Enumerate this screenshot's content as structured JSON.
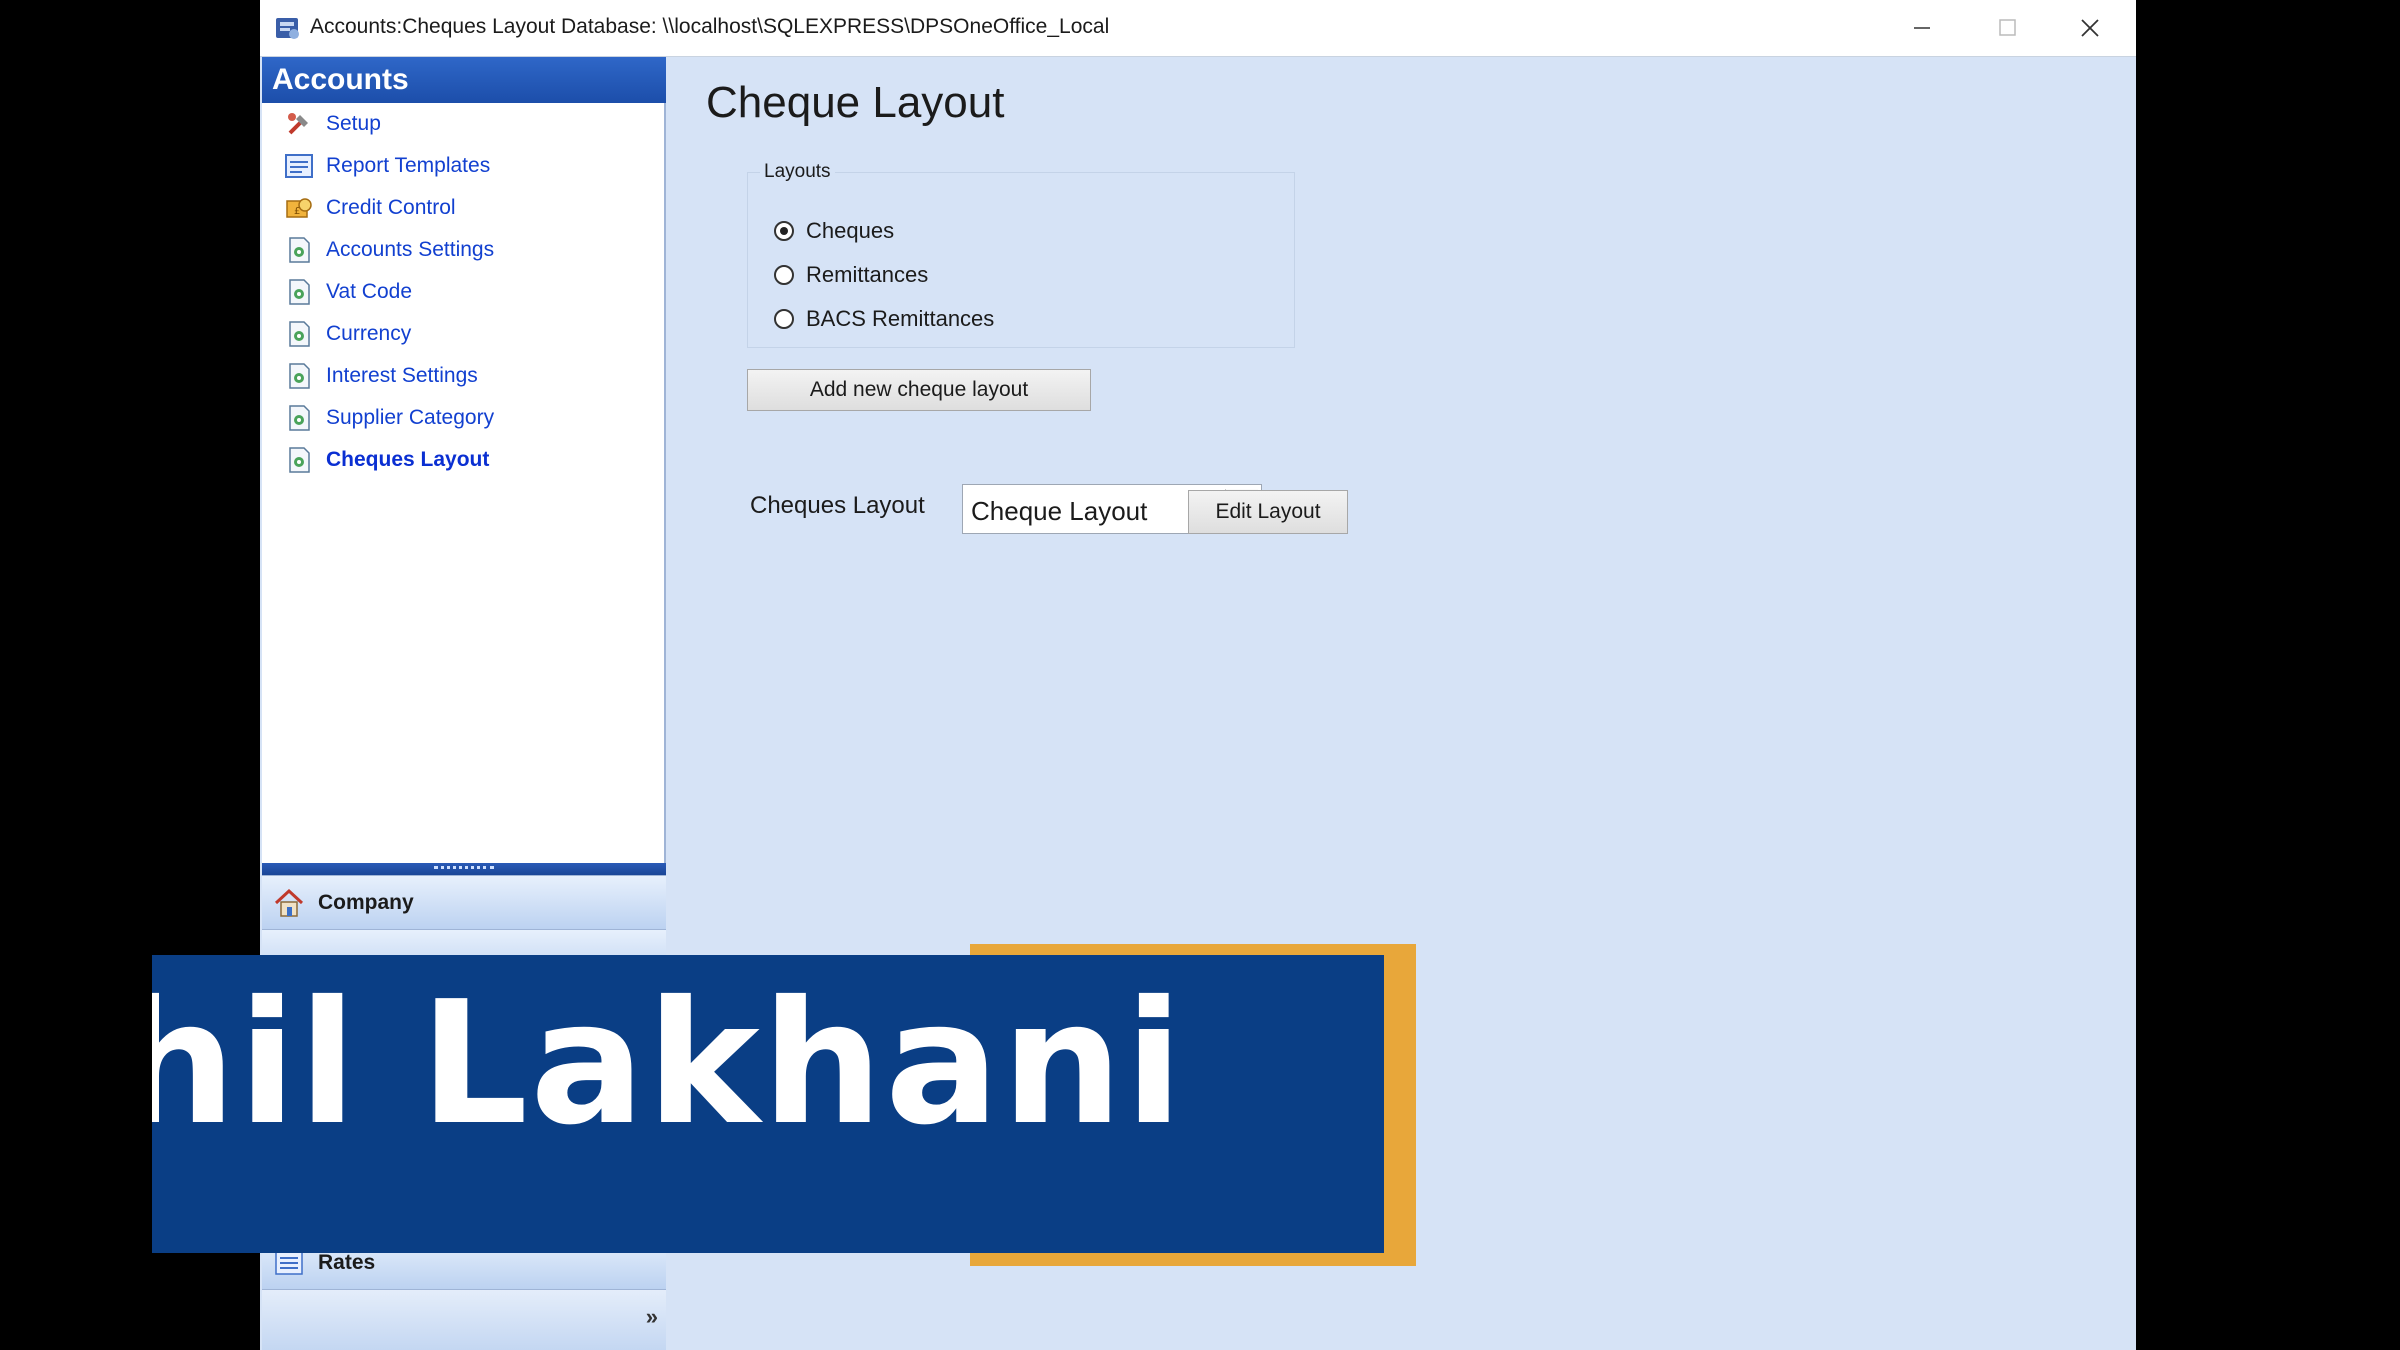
{
  "window": {
    "title": "Accounts:Cheques Layout Database: \\\\localhost\\SQLEXPRESS\\DPSOneOffice_Local",
    "controls": [
      "minimize",
      "maximize",
      "close"
    ]
  },
  "sidebar": {
    "header": "Accounts",
    "items": [
      {
        "label": "Setup",
        "icon": "tools-icon"
      },
      {
        "label": "Report Templates",
        "icon": "report-icon"
      },
      {
        "label": "Credit Control",
        "icon": "credit-icon"
      },
      {
        "label": "Accounts Settings",
        "icon": "settings-doc-icon"
      },
      {
        "label": "Vat Code",
        "icon": "settings-doc-icon"
      },
      {
        "label": "Currency",
        "icon": "settings-doc-icon"
      },
      {
        "label": "Interest Settings",
        "icon": "settings-doc-icon"
      },
      {
        "label": "Supplier Category",
        "icon": "settings-doc-icon"
      },
      {
        "label": "Cheques Layout",
        "icon": "settings-doc-icon",
        "active": true
      }
    ],
    "groups": [
      {
        "label": "Company",
        "icon": "house-icon"
      },
      {
        "label": "Rates",
        "icon": "list-icon"
      }
    ],
    "footer_chevron": "»"
  },
  "main": {
    "title": "Cheque Layout",
    "layouts_group": {
      "legend": "Layouts",
      "options": [
        {
          "label": "Cheques",
          "checked": true
        },
        {
          "label": "Remittances",
          "checked": false
        },
        {
          "label": "BACS Remittances",
          "checked": false
        }
      ]
    },
    "add_button": "Add new cheque layout",
    "cheques_layout_label": "Cheques Layout",
    "cheques_layout_value": "Cheque Layout",
    "edit_button": "Edit Layout"
  },
  "overlay": {
    "name_text": "hil Lakhani",
    "banner_color": "#0a3e85",
    "accent_color": "#e8a73a"
  },
  "colors": {
    "window_bg": "#d6e3f6",
    "sidebar_header": "#1c4eaa",
    "link": "#1240d0"
  }
}
